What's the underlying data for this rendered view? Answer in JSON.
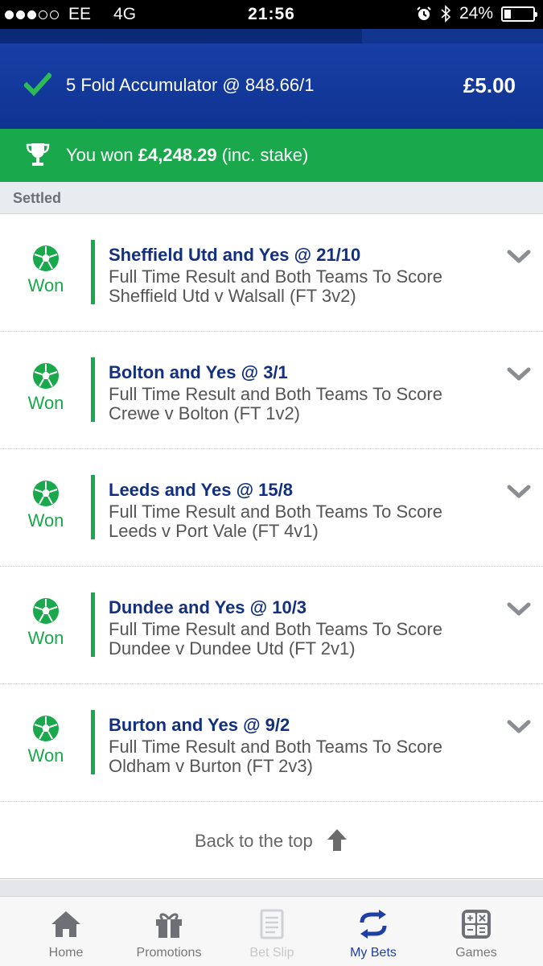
{
  "status_bar": {
    "carrier": "EE",
    "network": "4G",
    "time": "21:56",
    "battery": "24%",
    "battery_level": 0.24,
    "signal_bars_filled": 3,
    "signal_bars_total": 5
  },
  "accumulator": {
    "title": "5 Fold Accumulator @ 848.66/1",
    "stake": "£5.00",
    "icon": "check-icon"
  },
  "result_banner": {
    "prefix": "You won ",
    "amount": "£4,248.29",
    "suffix": " (inc. stake)",
    "icon": "trophy-icon"
  },
  "section_label": "Settled",
  "legs": [
    {
      "status": "Won",
      "selection": "Sheffield Utd and Yes @ 21/10",
      "market": "Full Time Result and Both Teams To Score",
      "event": "Sheffield Utd v Walsall (FT 3v2)"
    },
    {
      "status": "Won",
      "selection": "Bolton and Yes @ 3/1",
      "market": "Full Time Result and Both Teams To Score",
      "event": "Crewe v Bolton (FT 1v2)"
    },
    {
      "status": "Won",
      "selection": "Leeds and Yes @ 15/8",
      "market": "Full Time Result and Both Teams To Score",
      "event": "Leeds v Port Vale (FT 4v1)"
    },
    {
      "status": "Won",
      "selection": "Dundee and Yes @ 10/3",
      "market": "Full Time Result and Both Teams To Score",
      "event": "Dundee v Dundee Utd (FT 2v1)"
    },
    {
      "status": "Won",
      "selection": "Burton and Yes @ 9/2",
      "market": "Full Time Result and Both Teams To Score",
      "event": "Oldham v Burton (FT 2v3)"
    }
  ],
  "back_to_top": "Back to the top",
  "tabs": [
    {
      "label": "Home",
      "icon": "home-icon",
      "state": "normal"
    },
    {
      "label": "Promotions",
      "icon": "gift-icon",
      "state": "normal"
    },
    {
      "label": "Bet Slip",
      "icon": "betslip-icon",
      "state": "disabled"
    },
    {
      "label": "My Bets",
      "icon": "mybets-icon",
      "state": "active"
    },
    {
      "label": "Games",
      "icon": "games-icon",
      "state": "normal"
    }
  ],
  "colors": {
    "brand_blue": "#173fa4",
    "win_green": "#19a84b",
    "selection_blue": "#12307f",
    "active_tab": "#1e3fa3"
  }
}
